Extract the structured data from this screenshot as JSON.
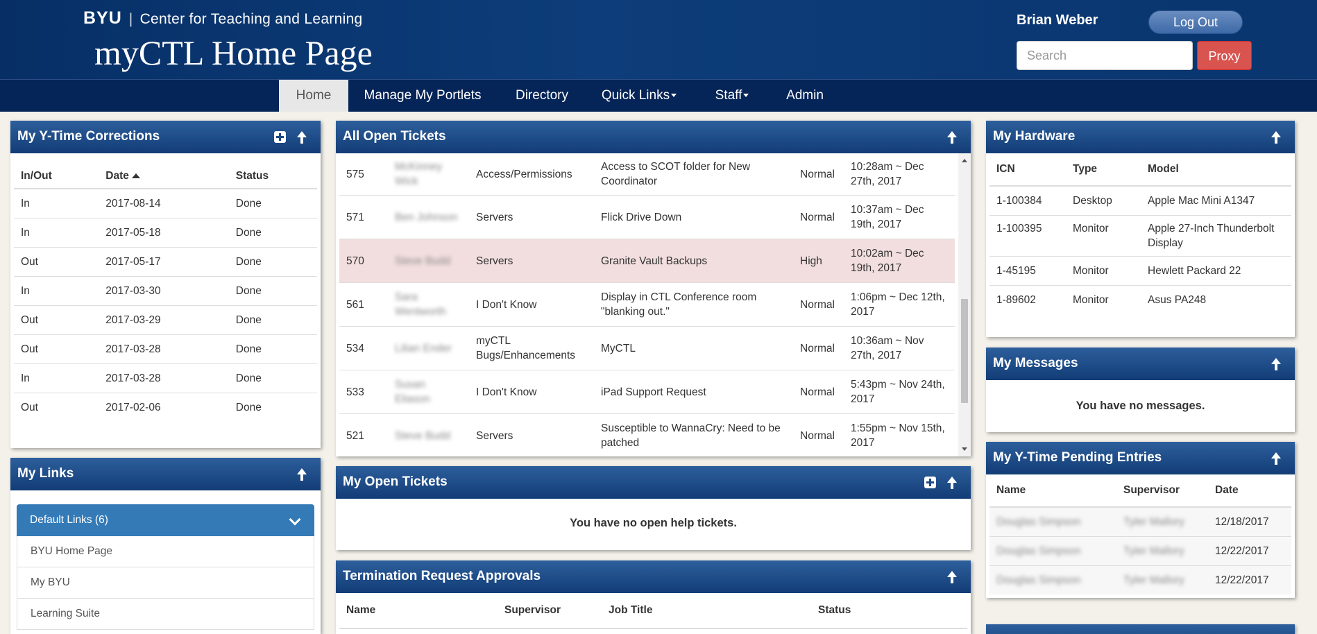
{
  "header": {
    "org_short": "BYU",
    "org_name": "Center for Teaching and Learning",
    "title": "myCTL Home Page",
    "user_name": "Brian Weber",
    "logout_label": "Log Out",
    "search_placeholder": "Search",
    "proxy_label": "Proxy"
  },
  "nav": {
    "items": [
      {
        "label": "Home"
      },
      {
        "label": "Manage My Portlets"
      },
      {
        "label": "Directory"
      },
      {
        "label": "Quick Links"
      },
      {
        "label": "Staff"
      },
      {
        "label": "Admin"
      }
    ]
  },
  "ytime_corrections": {
    "title": "My Y-Time Corrections",
    "columns": [
      "In/Out",
      "Date",
      "Status"
    ],
    "rows": [
      [
        "In",
        "2017-08-14",
        "Done"
      ],
      [
        "In",
        "2017-05-18",
        "Done"
      ],
      [
        "Out",
        "2017-05-17",
        "Done"
      ],
      [
        "In",
        "2017-03-30",
        "Done"
      ],
      [
        "Out",
        "2017-03-29",
        "Done"
      ],
      [
        "Out",
        "2017-03-28",
        "Done"
      ],
      [
        "In",
        "2017-03-28",
        "Done"
      ],
      [
        "Out",
        "2017-02-06",
        "Done"
      ]
    ]
  },
  "my_links": {
    "title": "My Links",
    "group_label": "Default Links (6)",
    "items": [
      "BYU Home Page",
      "My BYU",
      "Learning Suite"
    ]
  },
  "all_open_tickets": {
    "title": "All Open Tickets",
    "rows": [
      {
        "id": "575",
        "requester": "McKinney Wick",
        "category": "Access/Permissions",
        "subject": "Access to SCOT folder for New Coordinator",
        "priority": "Normal",
        "time": "10:28am ~ Dec 27th, 2017"
      },
      {
        "id": "571",
        "requester": "Ben Johnson",
        "category": "Servers",
        "subject": "Flick Drive Down",
        "priority": "Normal",
        "time": "10:37am ~ Dec 19th, 2017"
      },
      {
        "id": "570",
        "requester": "Steve Budd",
        "category": "Servers",
        "subject": "Granite Vault Backups",
        "priority": "High",
        "time": "10:02am ~ Dec 19th, 2017"
      },
      {
        "id": "561",
        "requester": "Sara Wentworth",
        "category": "I Don't Know",
        "subject": "Display in CTL Conference room \"blanking out.\"",
        "priority": "Normal",
        "time": "1:06pm ~ Dec 12th, 2017"
      },
      {
        "id": "534",
        "requester": "Lilian Ender",
        "category": "myCTL Bugs/Enhancements",
        "subject": "MyCTL",
        "priority": "Normal",
        "time": "10:36am ~ Nov 27th, 2017"
      },
      {
        "id": "533",
        "requester": "Susan Eliason",
        "category": "I Don't Know",
        "subject": "iPad Support Request",
        "priority": "Normal",
        "time": "5:43pm ~ Nov 24th, 2017"
      },
      {
        "id": "521",
        "requester": "Steve Budd",
        "category": "Servers",
        "subject": "Susceptible to WannaCry: Need to be patched",
        "priority": "Normal",
        "time": "1:55pm ~ Nov 15th, 2017"
      }
    ]
  },
  "my_open_tickets": {
    "title": "My Open Tickets",
    "empty_message": "You have no open help tickets."
  },
  "termination": {
    "title": "Termination Request Approvals",
    "columns": [
      "Name",
      "Supervisor",
      "Job Title",
      "Status"
    ]
  },
  "hardware": {
    "title": "My Hardware",
    "columns": [
      "ICN",
      "Type",
      "Model"
    ],
    "rows": [
      [
        "1-100384",
        "Desktop",
        "Apple Mac Mini A1347"
      ],
      [
        "1-100395",
        "Monitor",
        "Apple 27-Inch Thunderbolt Display"
      ],
      [
        "1-45195",
        "Monitor",
        "Hewlett Packard 22"
      ],
      [
        "1-89602",
        "Monitor",
        "Asus PA248"
      ]
    ]
  },
  "messages": {
    "title": "My Messages",
    "empty_message": "You have no messages."
  },
  "ytime_pending": {
    "title": "My Y-Time Pending Entries",
    "columns": [
      "Name",
      "Supervisor",
      "Date"
    ],
    "rows": [
      [
        "Douglas Simpson",
        "Tyler Mallory",
        "12/18/2017"
      ],
      [
        "Douglas Simpson",
        "Tyler Mallory",
        "12/22/2017"
      ],
      [
        "Douglas Simpson",
        "Tyler Mallory",
        "12/22/2017"
      ]
    ]
  }
}
